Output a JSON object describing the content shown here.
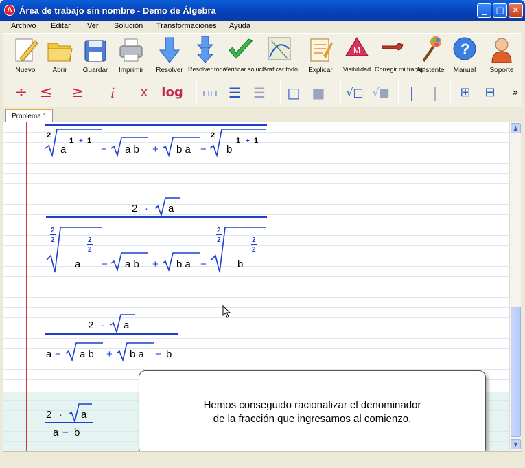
{
  "window": {
    "title": "Área de trabajo sin nombre - Demo de Álgebra",
    "icon": "app-logo-icon",
    "controls": [
      "minimize-icon",
      "maximize-icon",
      "close-icon"
    ]
  },
  "menu": [
    "Archivo",
    "Editar",
    "Ver",
    "Solución",
    "Transformaciones",
    "Ayuda"
  ],
  "toolbar": {
    "buttons": [
      {
        "label": "Nuevo",
        "icon": "new-document-icon"
      },
      {
        "label": "Abrir",
        "icon": "folder-icon"
      },
      {
        "label": "Guardar",
        "icon": "floppy-disk-icon"
      },
      {
        "label": "Imprimir",
        "icon": "printer-icon"
      },
      {
        "label": "Resolver",
        "icon": "solve-arrow-icon"
      },
      {
        "label": "Resolver todo",
        "icon": "solve-all-arrow-icon"
      },
      {
        "label": "Verificar solución",
        "icon": "checkmark-icon"
      },
      {
        "label": "Graficar todo",
        "icon": "graph-icon"
      },
      {
        "label": "Explicar",
        "icon": "explain-icon"
      },
      {
        "label": "Visibilidad",
        "icon": "visibility-icon"
      },
      {
        "label": "Corregir mi trabajo",
        "icon": "wrench-icon"
      },
      {
        "label": "Asistente",
        "icon": "wand-icon"
      },
      {
        "label": "Manual",
        "icon": "help-icon"
      },
      {
        "label": "Soporte",
        "icon": "support-person-icon"
      }
    ]
  },
  "math_toolbar": {
    "buttons": [
      "÷",
      "≤",
      "≥",
      "i",
      "x",
      "log"
    ],
    "overflow": "»"
  },
  "tabs": [
    {
      "label": "Problema 1",
      "active": true
    }
  ],
  "math": {
    "dot": "·",
    "two": "2",
    "var_a": "a",
    "var_b": "b",
    "one": "1",
    "plus": "+",
    "minus": "−",
    "ab": "a b",
    "ba": "b a"
  },
  "balloon": {
    "line1": "Hemos conseguido racionalizar el denominador",
    "line2": "de la fracción que ingresamos al comienzo."
  },
  "colors": {
    "title_bar": "#0a5fd8",
    "math_blue": "#1e3fd0",
    "margin_red": "#c83a3a"
  }
}
